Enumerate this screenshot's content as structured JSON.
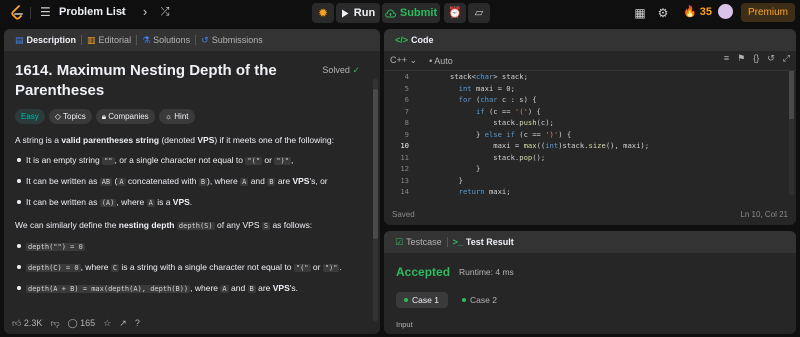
{
  "nav": {
    "title": "Problem List",
    "run": "Run",
    "submit": "Submit",
    "streak": "35",
    "premium": "Premium"
  },
  "colors": {
    "accent": "#ffa116",
    "success": "#2cbb5d",
    "easy": "#00b8a3"
  },
  "desc_tabs": [
    "Description",
    "Editorial",
    "Solutions",
    "Submissions"
  ],
  "problem": {
    "title": "1614. Maximum Nesting Depth of the Parentheses",
    "solved": "Solved",
    "difficulty": "Easy",
    "chips": [
      "Topics",
      "Companies",
      "Hint"
    ],
    "intro_a": "A string is a ",
    "intro_b": "valid parentheses string",
    "intro_c": " (denoted ",
    "intro_d": "VPS",
    "intro_e": ") if it meets one of the following:",
    "b1_a": "It is an empty string ",
    "b1_code1": "\"\"",
    "b1_b": ", or a single character not equal to ",
    "b1_code2": "\"(\"",
    "b1_c": " or ",
    "b1_code3": "\")\"",
    "b1_d": ",",
    "b2_a": "It can be written as ",
    "b2_code1": "AB",
    "b2_b": " (",
    "b2_code2": "A",
    "b2_c": " concatenated with ",
    "b2_code3": "B",
    "b2_d": "), where ",
    "b2_code4": "A",
    "b2_e": " and ",
    "b2_code5": "B",
    "b2_f": " are ",
    "b2_g": "VPS",
    "b2_h": "'s, or",
    "b3_a": "It can be written as ",
    "b3_code1": "(A)",
    "b3_b": ", where ",
    "b3_code2": "A",
    "b3_c": " is a ",
    "b3_d": "VPS",
    "b3_e": ".",
    "p2_a": "We can similarly define the ",
    "p2_b": "nesting depth",
    "p2_c": " ",
    "p2_code1": "depth(S)",
    "p2_d": " of any VPS ",
    "p2_code2": "S",
    "p2_e": " as follows:",
    "d1": "depth(\"\") = 0",
    "d2_code": "depth(C) = 0",
    "d2_a": ", where ",
    "d2_code2": "C",
    "d2_b": " is a string with a single character not equal to ",
    "d2_code3": "\"(\"",
    "d2_c": " or ",
    "d2_code4": "\")\"",
    "d2_d": ".",
    "d3_code": "depth(A + B) = max(depth(A), depth(B))",
    "d3_a": ", where ",
    "d3_code2": "A",
    "d3_b": " and ",
    "d3_code3": "B",
    "d3_c": " are ",
    "d3_d": "VPS",
    "d3_e": "'s."
  },
  "footer": {
    "likes": "2.3K",
    "comments": "165"
  },
  "code": {
    "header": "Code",
    "language": "C++",
    "mode": "Auto",
    "saved": "Saved",
    "position": "Ln 10, Col 21",
    "line_numbers": [
      "4",
      "5",
      "6",
      "7",
      "8",
      "9",
      "10",
      "11",
      "12",
      "13",
      "14"
    ]
  },
  "result": {
    "tabs": [
      "Testcase",
      "Test Result"
    ],
    "status": "Accepted",
    "runtime": "Runtime: 4 ms",
    "cases": [
      "Case 1",
      "Case 2"
    ],
    "input_label": "Input"
  }
}
